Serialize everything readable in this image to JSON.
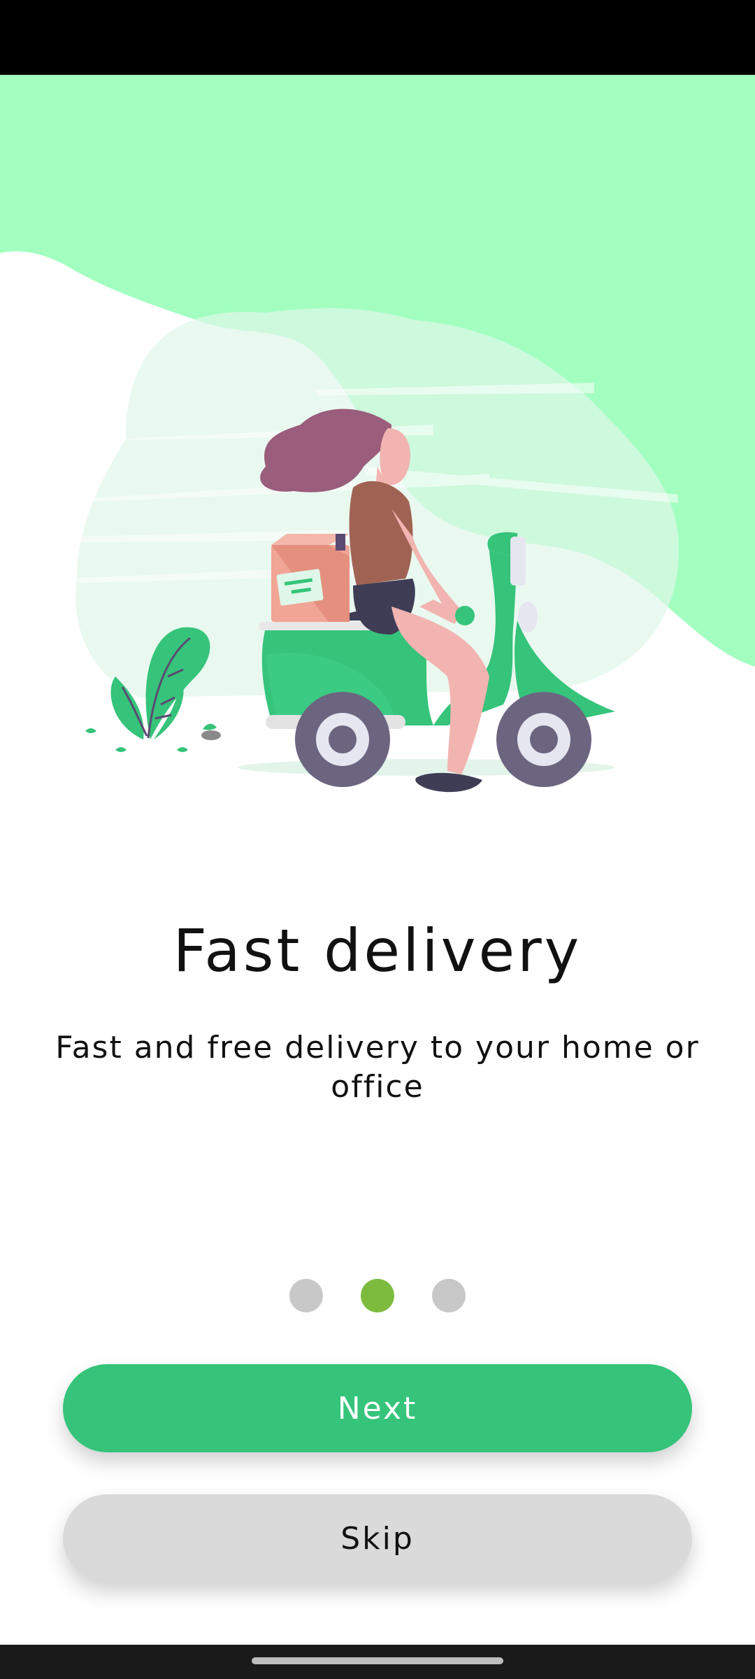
{
  "onboarding": {
    "title": "Fast delivery",
    "subtitle": "Fast and free delivery to your home or office",
    "page_indicator": {
      "total": 3,
      "active_index": 1
    },
    "buttons": {
      "next_label": "Next",
      "skip_label": "Skip"
    }
  },
  "colors": {
    "accent_green": "#35c47a",
    "active_dot": "#7dbb3f",
    "inactive_dot": "#c8c8c8",
    "hero_background": "#a2ffc0",
    "skip_button": "#dadada"
  }
}
